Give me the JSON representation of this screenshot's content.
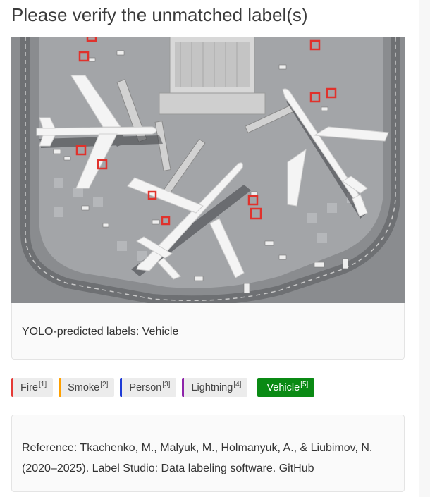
{
  "page": {
    "title": "Please verify the unmatched label(s)"
  },
  "image": {
    "description_icon": "airport-aerial-photo"
  },
  "prediction": {
    "text": "YOLO-predicted labels: Vehicle"
  },
  "labels": [
    {
      "name": "Fire",
      "hotkey": "[1]",
      "color": "#e53935",
      "selected": false
    },
    {
      "name": "Smoke",
      "hotkey": "[2]",
      "color": "#ffa000",
      "selected": false
    },
    {
      "name": "Person",
      "hotkey": "[3]",
      "color": "#1e3bd6",
      "selected": false
    },
    {
      "name": "Lightning",
      "hotkey": "[4]",
      "color": "#8e24aa",
      "selected": false
    },
    {
      "name": "Vehicle",
      "hotkey": "[5]",
      "color": "#0a8a14",
      "selected": true
    }
  ],
  "reference": {
    "text": "Reference: Tkachenko, M., Malyuk, M., Holmanyuk, A., & Liubimov, N. (2020–2025). Label Studio: Data labeling software. GitHub"
  }
}
